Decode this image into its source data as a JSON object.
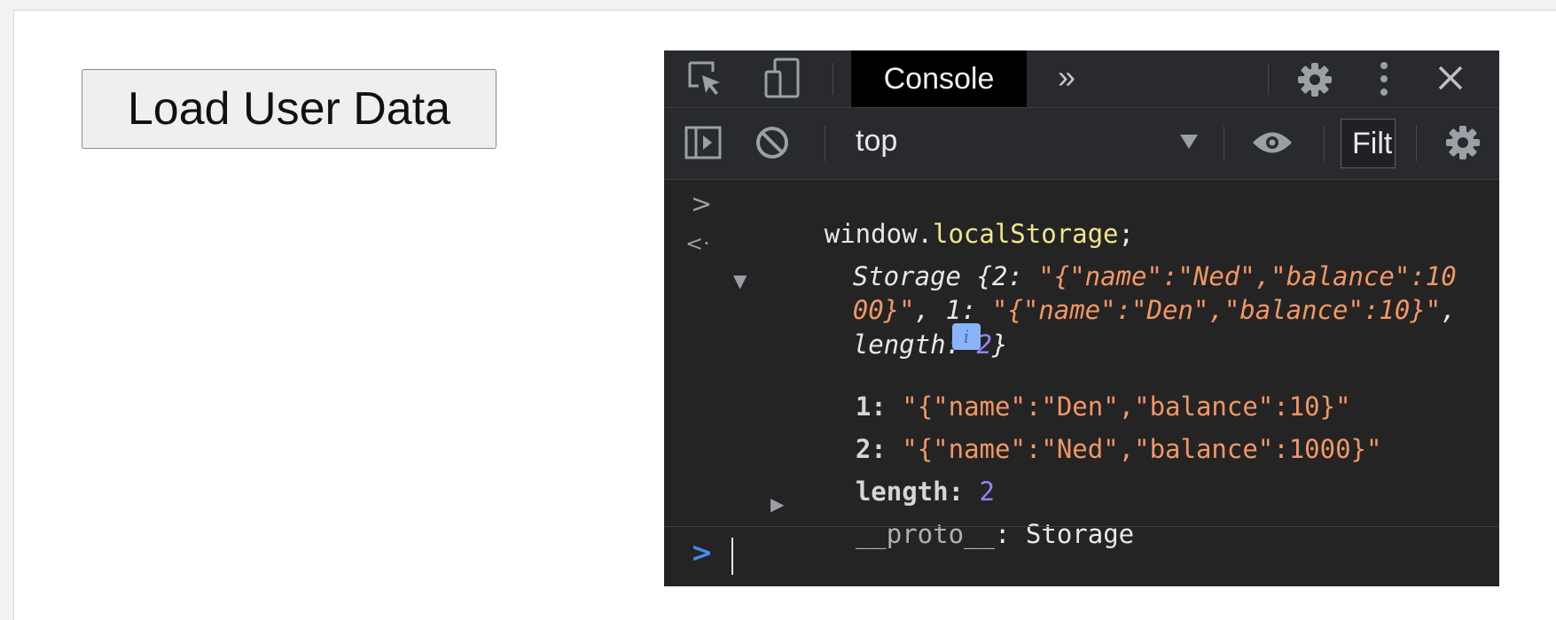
{
  "page": {
    "load_button_label": "Load User Data"
  },
  "devtools": {
    "tabs": {
      "active_label": "Console",
      "more_tabs": "»"
    },
    "toolbar": {
      "context": "top",
      "filter_text": "Filt"
    },
    "console": {
      "input_prompt": ">",
      "input_command_obj": "window.",
      "input_command_prop": "localStorage",
      "input_command_end": ";",
      "result_prompt": "<·",
      "summary_line1_prefix": "Storage {2: ",
      "summary_line1_str": "\"{\"name\":\"Ned\",\"balance\":10",
      "summary_line2_str": "00}\"",
      "summary_line2_mid": ", 1: ",
      "summary_line2_str2": "\"{\"name\":\"Den\",\"balance\":10}\"",
      "summary_line2_end": ",",
      "summary_line3_prefix": "length: ",
      "summary_line3_num": "2",
      "summary_line3_end": "}",
      "info_badge": "i",
      "entries": [
        {
          "key": "1: ",
          "value": "\"{\"name\":\"Den\",\"balance\":10}\""
        },
        {
          "key": "2: ",
          "value": "\"{\"name\":\"Ned\",\"balance\":1000}\""
        }
      ],
      "length_key": "length: ",
      "length_value": "2",
      "proto_key": "__proto__",
      "proto_sep": ": ",
      "proto_value": "Storage",
      "bottom_prompt": ">"
    },
    "colors": {
      "background": "#242424",
      "string": "#f29766",
      "number": "#9980ff",
      "property": "#f0e68c",
      "prompt_blue": "#4a8af4"
    }
  }
}
